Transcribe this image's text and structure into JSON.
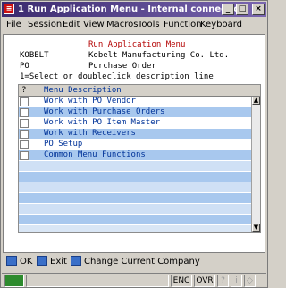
{
  "window": {
    "title": "1 Run Application Menu - Internal connection"
  },
  "menubar": [
    "File",
    "Session",
    "Edit",
    "View",
    "Macros",
    "Tools",
    "Function",
    "Keyboard"
  ],
  "header": {
    "title": "Run Application Menu",
    "company_code": "KOBELT",
    "company_name": "Kobelt Manufacturing Co. Ltd.",
    "module_code": "PO",
    "module_name": "Purchase Order",
    "instruction": "1=Select or doubleclick description line"
  },
  "grid": {
    "col_select": "?",
    "col_description": "Menu Description",
    "rows": [
      "Work with PO Vendor",
      "Work with Purchase Orders",
      "Work with PO Item Master",
      "Work with Receivers",
      "PO Setup",
      "Common Menu Functions"
    ]
  },
  "fkeys": {
    "ok": "OK",
    "exit": "Exit",
    "change": "Change Current Company"
  },
  "statusbar": {
    "enc": "ENC",
    "ovr": "OVR"
  }
}
